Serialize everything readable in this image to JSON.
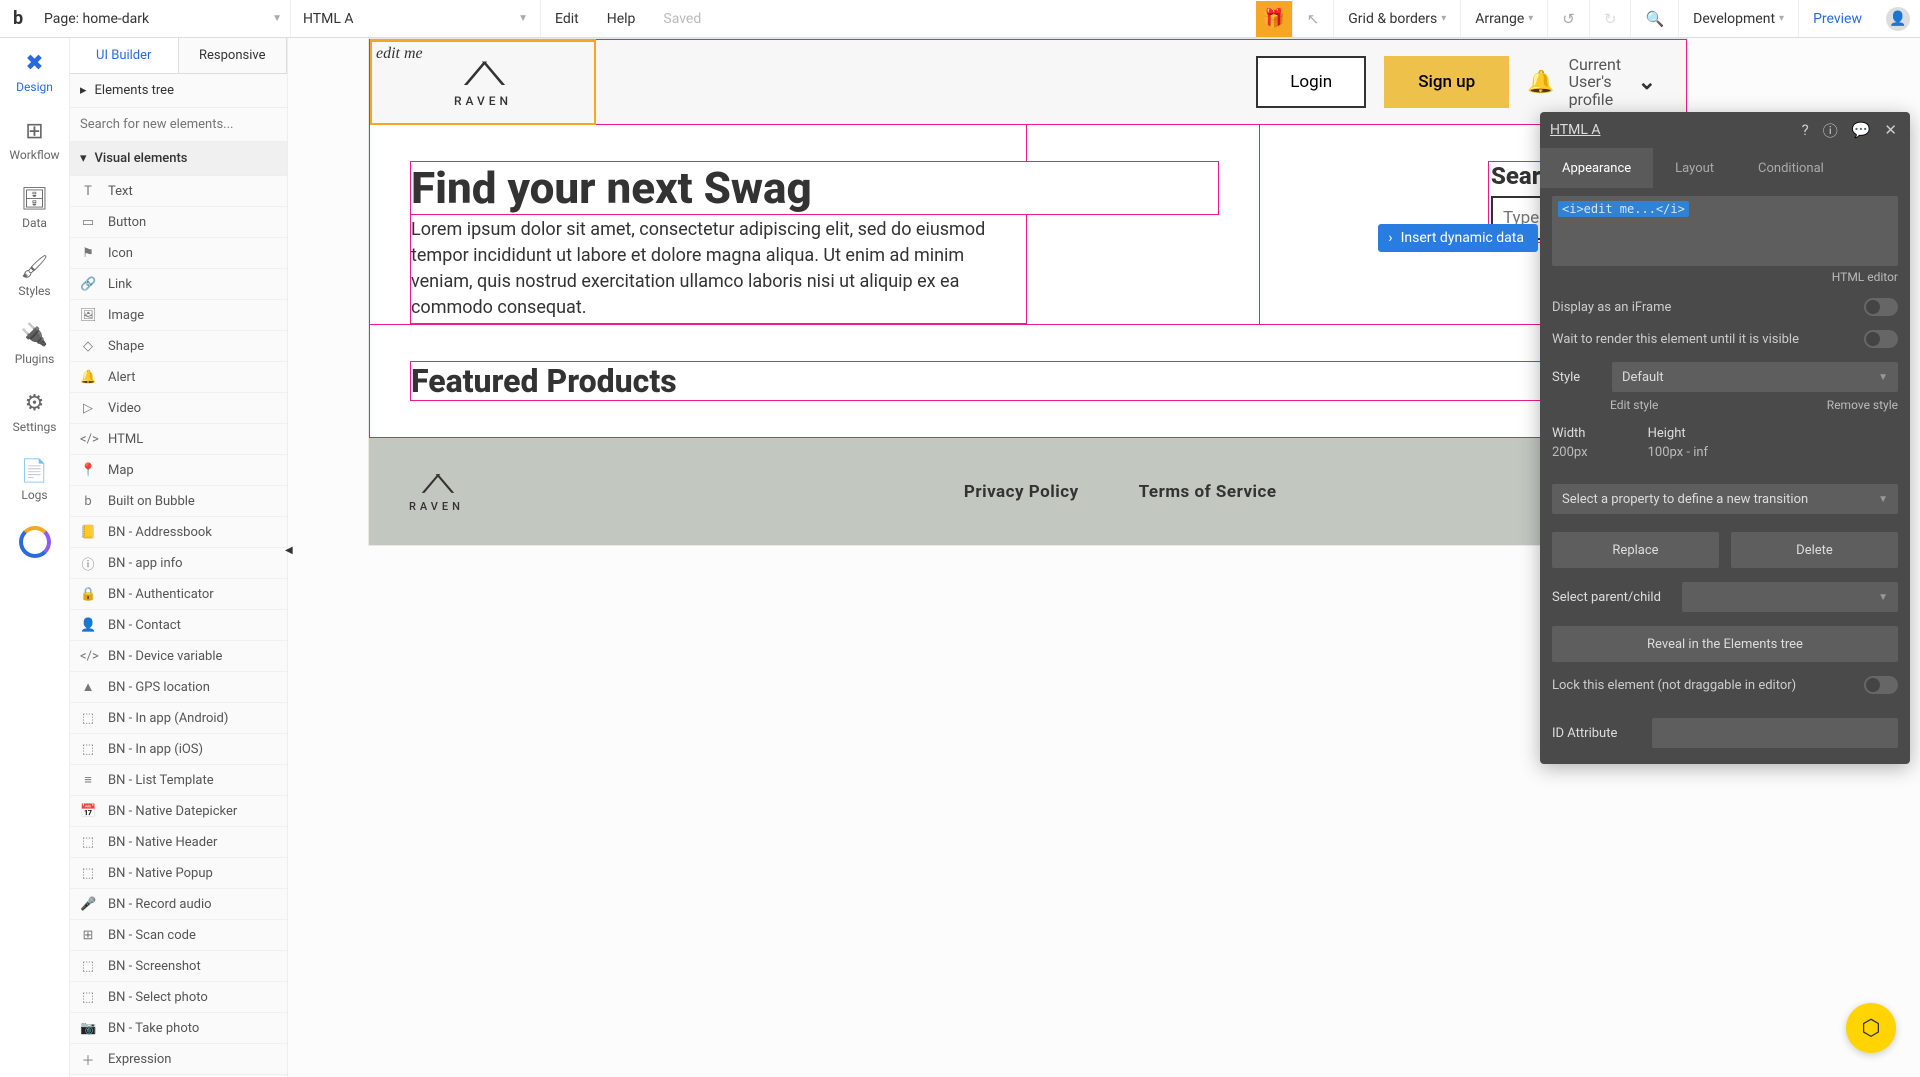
{
  "topbar": {
    "page_label": "Page: home-dark",
    "element_label": "HTML A",
    "menu": {
      "edit": "Edit",
      "help": "Help",
      "saved": "Saved"
    },
    "right": {
      "grid": "Grid & borders",
      "arrange": "Arrange",
      "mode": "Development",
      "preview": "Preview"
    }
  },
  "rail": {
    "design": "Design",
    "workflow": "Workflow",
    "data": "Data",
    "styles": "Styles",
    "plugins": "Plugins",
    "settings": "Settings",
    "logs": "Logs"
  },
  "leftpanel": {
    "tabs": {
      "ui": "UI Builder",
      "responsive": "Responsive"
    },
    "elements_tree": "Elements tree",
    "search_placeholder": "Search for new elements...",
    "visual_header": "Visual elements",
    "items": [
      "Text",
      "Button",
      "Icon",
      "Link",
      "Image",
      "Shape",
      "Alert",
      "Video",
      "HTML",
      "Map",
      "Built on Bubble",
      "BN - Addressbook",
      "BN - app info",
      "BN - Authenticator",
      "BN - Contact",
      "BN - Device variable",
      "BN - GPS location",
      "BN - In app (Android)",
      "BN - In app (iOS)",
      "BN - List Template",
      "BN - Native Datepicker",
      "BN - Native Header",
      "BN - Native Popup",
      "BN - Record audio",
      "BN - Scan code",
      "BN - Screenshot",
      "BN - Select photo",
      "BN - Take photo",
      "Expression"
    ]
  },
  "canvas": {
    "edit_me": "edit me",
    "brand": "RAVEN",
    "login": "Login",
    "signup": "Sign up",
    "user": "Current User's profile",
    "h1": "Find your next Swag",
    "body": "Lorem ipsum dolor sit amet, consectetur adipiscing elit, sed do eiusmod tempor incididunt ut labore et dolore magna aliqua. Ut enim ad minim veniam, quis nostrud exercitation ullamco laboris nisi ut aliquip ex ea commodo consequat.",
    "search_title": "Search for S",
    "search_placeholder": "Type here...",
    "h2": "Featured Products",
    "footer": {
      "privacy": "Privacy Policy",
      "terms": "Terms of Service"
    }
  },
  "dynamic": {
    "label": "Insert dynamic data"
  },
  "inspector": {
    "title": "HTML A",
    "tabs": {
      "appearance": "Appearance",
      "layout": "Layout",
      "conditional": "Conditional"
    },
    "code": "<i>edit me...</i>",
    "html_editor": "HTML editor",
    "iframe": "Display as an iFrame",
    "wait": "Wait to render this element until it is visible",
    "style_label": "Style",
    "style_value": "Default",
    "edit_style": "Edit style",
    "remove_style": "Remove style",
    "width_label": "Width",
    "width_value": "200px",
    "height_label": "Height",
    "height_value": "100px - inf",
    "transition": "Select a property to define a new transition",
    "replace": "Replace",
    "delete": "Delete",
    "parent_label": "Select parent/child",
    "reveal": "Reveal in the Elements tree",
    "lock": "Lock this element (not draggable in editor)",
    "id_label": "ID Attribute"
  }
}
